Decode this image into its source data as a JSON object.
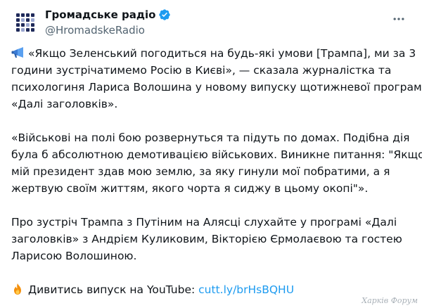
{
  "author": {
    "display_name": "Громадське радіо",
    "handle": "@HromadskeRadio",
    "verified_color": "#1d9bf0",
    "avatar_color": "#1f2a5a"
  },
  "more_icon": "ellipsis-icon",
  "tweet": {
    "p1_icon": "megaphone-icon",
    "p1_lines": [
      "«Якщо Зеленський погодиться на будь-які умови [Трампа], ми за 3",
      "години зустрічатимемо Росію в Києві», — сказала журналістка та",
      "психологиня Лариса Волошина у новому випуску щотижневої програми",
      "«Далі заголовків»."
    ],
    "p2_lines": [
      "«Військові на полі бою розвернуться та підуть по домах. Подібна дія",
      "була б абсолютною демотивацією військових. Виникне питання: \"Якщо",
      "мій президент здав мою землю, за яку гинули мої побратими, а я",
      "жертвую своїм життям, якого чорта я сиджу в цьому окопі\"»."
    ],
    "p3_lines": [
      "Про зустріч Трампа з Путіним на Алясці слухайте у програмі «Далі",
      "заголовків» з Андрієм Куликовим, Вікторією Єрмолаєвою та гостею",
      "Ларисою Волошиною."
    ],
    "p4_icon": "fire-icon",
    "p4_text": "Дивитись випуск на YouTube: ",
    "p4_link": "cutt.ly/brHsBQHU"
  },
  "watermark": "Харків Форум",
  "colors": {
    "text": "#0f1419",
    "secondary": "#536471",
    "link": "#1d9bf0"
  }
}
